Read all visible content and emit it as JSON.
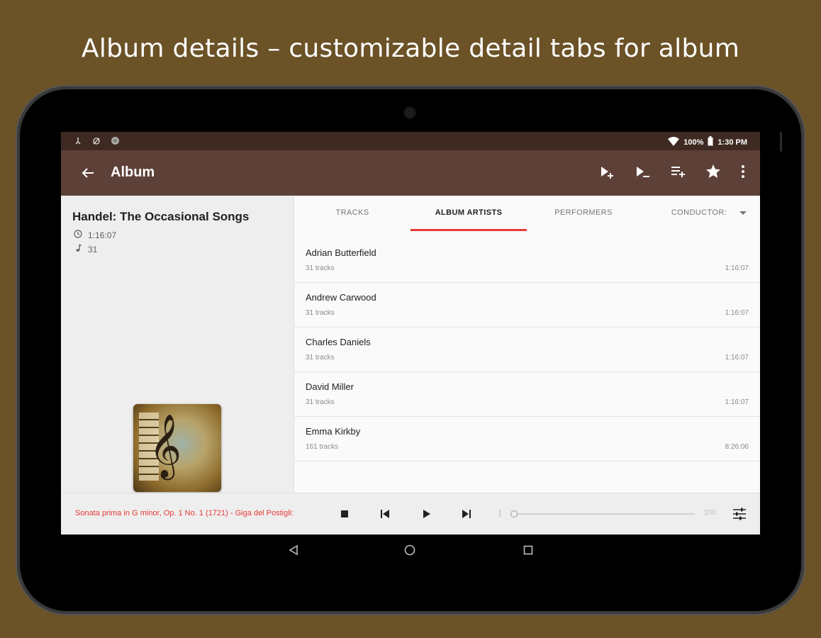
{
  "headline": "Album details – customizable detail tabs for album",
  "status": {
    "battery": "100%",
    "time": "1:30 PM"
  },
  "appbar": {
    "title": "Album"
  },
  "album": {
    "title": "Handel: The Occasional Songs",
    "duration": "1:16:07",
    "tracks": "31"
  },
  "tabs": [
    {
      "label": "TRACKS"
    },
    {
      "label": "ALBUM ARTISTS"
    },
    {
      "label": "PERFORMERS"
    },
    {
      "label": "CONDUCTOR:"
    }
  ],
  "artists": [
    {
      "name": "Adrian Butterfield",
      "count": "31 tracks",
      "duration": "1:16:07"
    },
    {
      "name": "Andrew Carwood",
      "count": "31 tracks",
      "duration": "1:16:07"
    },
    {
      "name": "Charles Daniels",
      "count": "31 tracks",
      "duration": "1:16:07"
    },
    {
      "name": "David Miller",
      "count": "31 tracks",
      "duration": "1:16:07"
    },
    {
      "name": "Emma Kirkby",
      "count": "161 tracks",
      "duration": "8:26:06"
    }
  ],
  "player": {
    "now_playing": "Sonata prima in G minor, Op. 1 No. 1 (1721) - Giga del Postigli:",
    "volume_max": "100"
  },
  "colors": {
    "background": "#6b5227",
    "statusbar": "#3e2a22",
    "appbar": "#5d4037",
    "accent": "#e53935"
  },
  "icons": [
    "add-to-queue-icon",
    "play-next-icon",
    "add-to-playlist-icon",
    "star-icon",
    "more-icon",
    "back-arrow-icon",
    "clock-icon",
    "music-note-icon",
    "stop-icon",
    "previous-icon",
    "play-icon",
    "next-icon",
    "equalizer-icon",
    "nav-back-icon",
    "nav-home-icon",
    "nav-recents-icon"
  ]
}
